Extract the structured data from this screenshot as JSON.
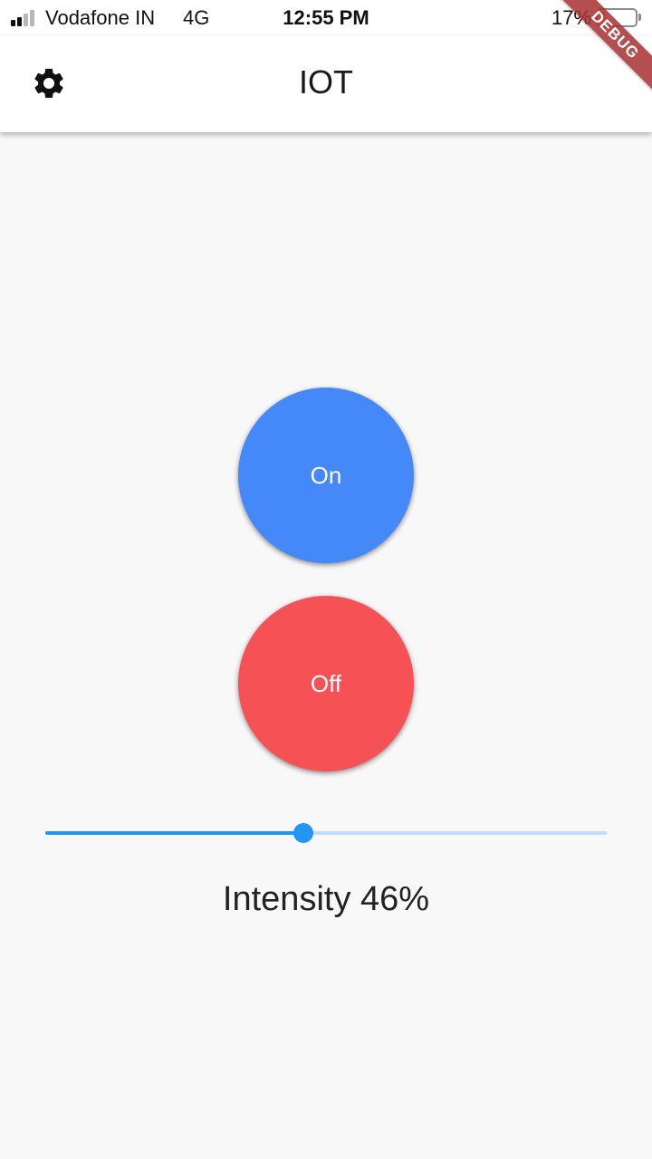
{
  "status_bar": {
    "carrier": "Vodafone IN",
    "network": "4G",
    "time": "12:55 PM",
    "battery_percent_text": "17%",
    "battery_level": 0.17,
    "signal_bars_active": 2
  },
  "app_bar": {
    "title": "IOT",
    "settings_icon": "gear-icon"
  },
  "debug_banner": "DEBUG",
  "controls": {
    "on_label": "On",
    "off_label": "Off",
    "on_color": "#4488FA",
    "off_color": "#F65255"
  },
  "slider": {
    "value": 0.46,
    "active_color": "#2196F3"
  },
  "intensity_label": "Intensity 46%"
}
